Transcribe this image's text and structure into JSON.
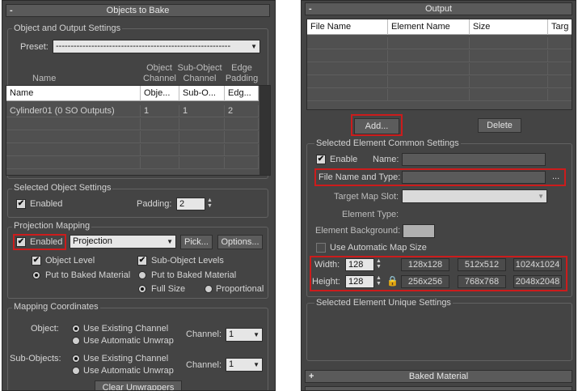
{
  "left": {
    "header": {
      "title": "Objects to Bake",
      "toggle": "-"
    },
    "object_output": {
      "title": "Object and Output Settings",
      "preset_label": "Preset:",
      "preset_value": "-----------------------------------------------------------",
      "col_headers": {
        "name": "Name",
        "object_channel": "Object\nChannel",
        "sub_object_channel": "Sub-Object\nChannel",
        "edge_padding": "Edge\nPadding"
      },
      "table_headers": [
        "Name",
        "Obje...",
        "Sub-O...",
        "Edg..."
      ],
      "rows": [
        [
          "Cylinder01 (0 SO Outputs)",
          "1",
          "1",
          "2"
        ]
      ]
    },
    "selected_object": {
      "title": "Selected Object Settings",
      "enabled_label": "Enabled",
      "padding_label": "Padding:",
      "padding_value": "2"
    },
    "projection": {
      "title": "Projection Mapping",
      "enabled_label": "Enabled",
      "dropdown_value": "Projection",
      "pick_label": "Pick...",
      "options_label": "Options...",
      "object_level": "Object Level",
      "sub_object_levels": "Sub-Object Levels",
      "put_to_baked_1": "Put to Baked Material",
      "put_to_baked_2": "Put to Baked Material",
      "full_size": "Full Size",
      "proportional": "Proportional"
    },
    "mapping_coords": {
      "title": "Mapping Coordinates",
      "object_label": "Object:",
      "sub_objects_label": "Sub-Objects:",
      "use_existing": "Use Existing Channel",
      "use_auto_unwrap": "Use Automatic Unwrap",
      "use_existing_2": "Use Existing Channel",
      "use_auto_unwrap_2": "Use Automatic Unwrap",
      "channel_label": "Channel:",
      "channel_value": "1",
      "channel_label_2": "Channel:",
      "channel_value_2": "1",
      "clear_unwrappers": "Clear Unwrappers"
    }
  },
  "right": {
    "header": {
      "title": "Output",
      "toggle": "-"
    },
    "table_headers": [
      "File Name",
      "Element Name",
      "Size",
      "Targ"
    ],
    "add_label": "Add...",
    "delete_label": "Delete",
    "common": {
      "title": "Selected Element Common Settings",
      "enable_label": "Enable",
      "name_label": "Name:",
      "file_name_type_label": "File Name and Type:",
      "browse": "...",
      "target_map_slot": "Target Map Slot:",
      "element_type": "Element Type:",
      "element_background": "Element Background:",
      "use_auto_map_size": "Use Automatic Map Size",
      "width_label": "Width:",
      "width_value": "128",
      "height_label": "Height:",
      "height_value": "128",
      "sizes_row1": [
        "128x128",
        "512x512",
        "1024x1024"
      ],
      "sizes_row2": [
        "256x256",
        "768x768",
        "2048x2048"
      ]
    },
    "unique": {
      "title": "Selected Element Unique Settings"
    },
    "baked_material": {
      "title": "Baked Material",
      "toggle": "+"
    }
  }
}
